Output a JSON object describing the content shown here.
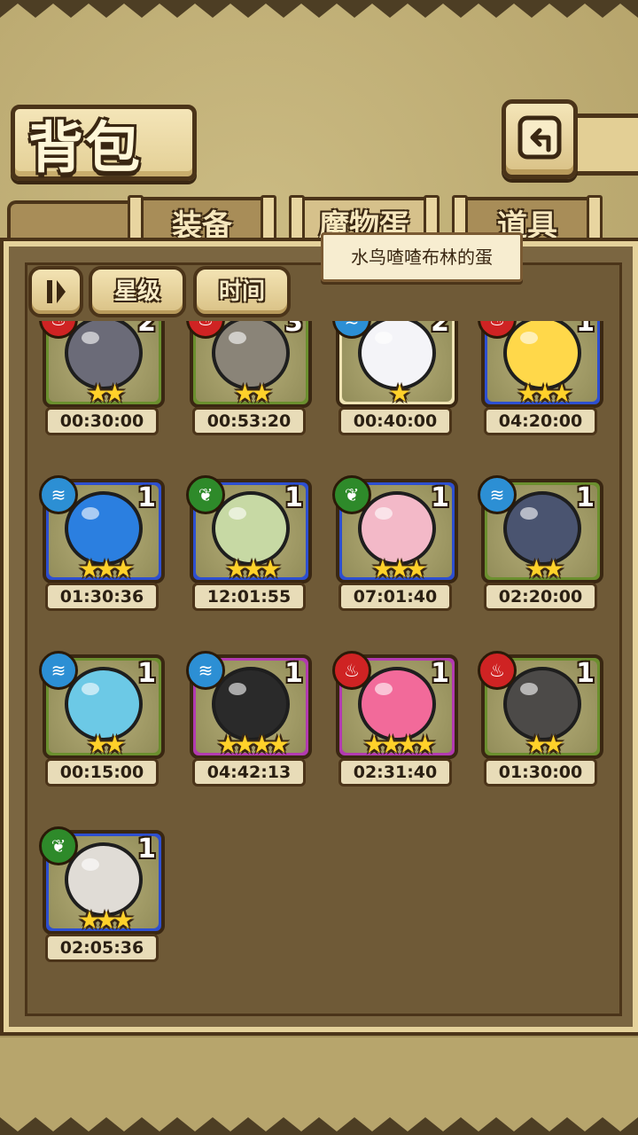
{
  "header": {
    "title": "背包",
    "back_icon": "back-arrow-icon"
  },
  "tabs": [
    {
      "label": "装备",
      "active": false
    },
    {
      "label": "魔物蛋",
      "active": true
    },
    {
      "label": "道具",
      "active": false
    }
  ],
  "sort": {
    "toggle_icon": "sort-toggle-icon",
    "star_label": "星级",
    "time_label": "时间"
  },
  "tooltip": {
    "text": "水鸟喳喳布林的蛋"
  },
  "colors": {
    "green_frame": "#6b8f2e",
    "blue_frame": "#2d4fd0",
    "purple_frame": "#b23ab0",
    "beige_frame": "#efe3b3",
    "water": "#2c8fd4",
    "grass": "#2e8a2a",
    "fire": "#cf2323"
  },
  "eggs": [
    {
      "count": "2",
      "stars": "★★",
      "time": "00:30:00",
      "frame": "green",
      "element": "fire",
      "art": "witch-hat-egg"
    },
    {
      "count": "3",
      "stars": "★★",
      "time": "00:53:20",
      "frame": "green",
      "element": "fire",
      "art": "stone-egg"
    },
    {
      "count": "2",
      "stars": "★",
      "time": "00:40:00",
      "frame": "beige",
      "element": "water",
      "art": "white-feather-egg"
    },
    {
      "count": "1",
      "stars": "★★★",
      "time": "04:20:00",
      "frame": "blue",
      "element": "fire",
      "art": "sun-egg"
    },
    {
      "count": "1",
      "stars": "★★★",
      "time": "01:30:36",
      "frame": "blue",
      "element": "water",
      "art": "blue-cat-egg"
    },
    {
      "count": "1",
      "stars": "★★★",
      "time": "12:01:55",
      "frame": "blue",
      "element": "grass",
      "art": "leaf-spiral-egg"
    },
    {
      "count": "1",
      "stars": "★★★",
      "time": "07:01:40",
      "frame": "blue",
      "element": "grass",
      "art": "lotus-egg"
    },
    {
      "count": "1",
      "stars": "★★",
      "time": "02:20:00",
      "frame": "green",
      "element": "water",
      "art": "shell-egg"
    },
    {
      "count": "1",
      "stars": "★★",
      "time": "00:15:00",
      "frame": "green",
      "element": "water",
      "art": "snail-egg"
    },
    {
      "count": "1",
      "stars": "★★★★",
      "time": "04:42:13",
      "frame": "purple",
      "element": "water",
      "art": "spike-egg"
    },
    {
      "count": "1",
      "stars": "★★★★",
      "time": "02:31:40",
      "frame": "purple",
      "element": "fire",
      "art": "crown-egg"
    },
    {
      "count": "1",
      "stars": "★★",
      "time": "01:30:00",
      "frame": "green",
      "element": "fire",
      "art": "dark-stone-egg"
    },
    {
      "count": "1",
      "stars": "★★★",
      "time": "02:05:36",
      "frame": "blue",
      "element": "grass",
      "art": "spiked-collar-egg"
    }
  ]
}
